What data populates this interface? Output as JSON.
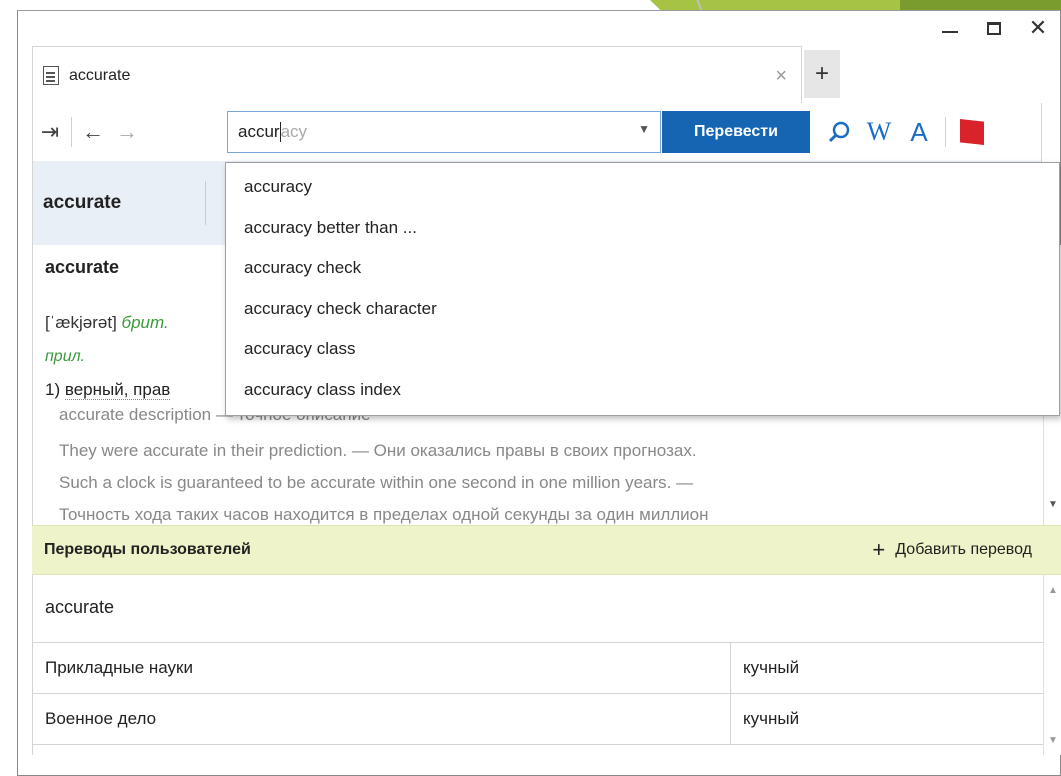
{
  "window": {
    "minimize_icon": "minimize-icon",
    "maximize_icon": "maximize-icon",
    "close_icon": "close-icon"
  },
  "tab": {
    "title": "accurate",
    "close_glyph": "×",
    "new_tab_glyph": "+"
  },
  "toolbar": {
    "pin_glyph": "⇥",
    "back_glyph": "←",
    "forward_glyph": "→",
    "search_value": "accur",
    "search_autocomplete": "acy",
    "translate_label": "Перевести",
    "wiki_glyph": "W",
    "font_glyph": "A"
  },
  "word_tabs": {
    "active": "accurate"
  },
  "article": {
    "headword": "accurate",
    "transcription": "[ˈækjərət]",
    "region_label": "брит.",
    "part_of_speech": "прил.",
    "meaning_number": "1)",
    "meaning_text": "верный, прав",
    "examples": [
      "accurate description — точное описание",
      "They were accurate in their prediction. — Они оказались правы в своих прогнозах.",
      "Such a clock is guaranteed to be accurate within one second in one million years. —",
      "Точность хода таких часов находится в пределах одной секунды за один миллион"
    ]
  },
  "user_translations": {
    "title": "Переводы пользователей",
    "add_label": "Добавить перевод",
    "word": "accurate",
    "rows": [
      {
        "field": "Прикладные науки",
        "translation": "кучный"
      },
      {
        "field": "Военное дело",
        "translation": "кучный"
      }
    ]
  },
  "autocomplete": {
    "items": [
      "accuracy",
      "accuracy better than ...",
      "accuracy check",
      "accuracy check character",
      "accuracy class",
      "accuracy class index"
    ]
  },
  "colors": {
    "accent": "#1565b3",
    "user_header_bg": "#eef3c9",
    "word_tabs_bg": "#e9eff6",
    "label_green": "#3a9a3a"
  }
}
